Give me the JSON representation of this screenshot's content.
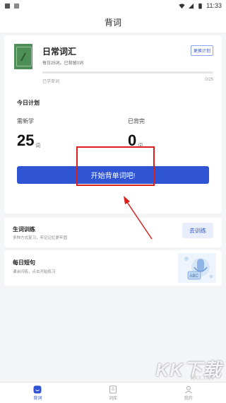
{
  "status_bar": {
    "time": "11:33"
  },
  "header": {
    "title": "背词"
  },
  "book": {
    "title": "日常词汇",
    "subtitle": "每日25词。已背留0词",
    "change_plan_label": "更换计划",
    "learned_label": "已学单词",
    "learned_count": "0/25",
    "progress_fraction": 0
  },
  "plan": {
    "title": "今日计划",
    "need_label": "需新学",
    "need_value": "25",
    "need_unit": "词",
    "done_label": "已背完",
    "done_value": "0",
    "done_unit": "词",
    "start_button_label": "开始背单词吧!"
  },
  "training": {
    "title": "生词训练",
    "subtitle": "多种方式复习，牢记记忆更牢固",
    "button_label": "去训练"
  },
  "daily": {
    "title": "每日短句",
    "subtitle": "课余闪练，点击开始练习"
  },
  "bottom_nav": {
    "items": [
      {
        "label": "背词",
        "icon": "smile-icon",
        "active": true
      },
      {
        "label": "词库",
        "icon": "book-icon",
        "active": false
      },
      {
        "label": "我的",
        "icon": "user-icon",
        "active": false
      }
    ]
  },
  "watermark": {
    "text": "KK下载",
    "sub": "kkx.net"
  },
  "colors": {
    "accent": "#2f55d4",
    "annotation_red": "#d8201c",
    "book_cover": "#4e8f57"
  }
}
